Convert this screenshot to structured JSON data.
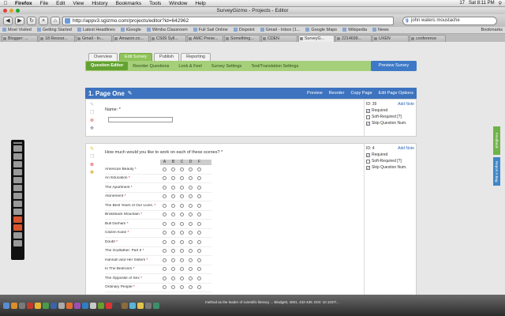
{
  "menubar": {
    "items": [
      "Firefox",
      "File",
      "Edit",
      "View",
      "History",
      "Bookmarks",
      "Tools",
      "Window",
      "Help"
    ],
    "right_text": "17",
    "clock": "Sat 8:11 PM"
  },
  "window": {
    "title": "SurveyGizmo - Projects - Editor"
  },
  "navbar": {
    "url": "http://appv3.sgizmo.com/projects/editor?id=642962",
    "search_value": "john waters moustache"
  },
  "bookmarks": {
    "items": [
      "Most Visited",
      "Getting Started",
      "Latest Headlines",
      "iGoogle",
      "Wimba Classroom",
      "Full Sail Online",
      "Dispoint",
      "Gmail - Inbox (1...",
      "Google Maps",
      "Wikipedia",
      "News"
    ],
    "right": "Bookmarks"
  },
  "tabs": [
    "Blogger: ...",
    "18 Resour...",
    "Gmail - In...",
    "Amazon.co...",
    "CS09 Syll...",
    "AMC Prese...",
    "Something...",
    "CDEN",
    "SurveyG...",
    "2214699...",
    "UXEN",
    "conference"
  ],
  "editor_tabs": [
    "Overview",
    "Edit Survey",
    "Publish",
    "Reporting"
  ],
  "subnav": {
    "items": [
      "Question Editor",
      "Reorder Questions",
      "Look & Feel",
      "Survey Settings",
      "Text/Translation Settings"
    ],
    "preview": "Preview Survey"
  },
  "page": {
    "title": "1. Page One",
    "links": [
      "Preview",
      "Reorder",
      "Copy Page",
      "Edit Page Options"
    ]
  },
  "q1": {
    "text": "Name: *",
    "id": "ID: 39",
    "add_note": "Add Note",
    "options": [
      "Required",
      "Soft-Required [?]",
      "Skip Question Num."
    ]
  },
  "q2": {
    "text": "How much would you like to work on each of these scenes? *",
    "id": "ID: 4",
    "add_note": "Add Note",
    "options": [
      "Required",
      "Soft-Required [?]",
      "Skip Question Num."
    ],
    "columns": [
      "A",
      "B",
      "C",
      "D",
      "F"
    ],
    "rows": [
      "American Beauty",
      "An Education",
      "The Apartment",
      "Atonement",
      "The Best Years of Our Lives.",
      "Brokeback Mountain",
      "Bull Durham",
      "Citizen Kane",
      "Doubt",
      "The Godfather: Part II",
      "Hannah and Her Sisters",
      "In The Bedroom",
      "The Opposite of Sex",
      "Ordinary People"
    ]
  },
  "feedback": {
    "a": "Feedback",
    "b": "Report A Bug"
  },
  "statusbar": {
    "text": "method as the leader of scientific literacy ...  Blodgett, 4001, 432-436. DOI: 10.1037/..."
  }
}
